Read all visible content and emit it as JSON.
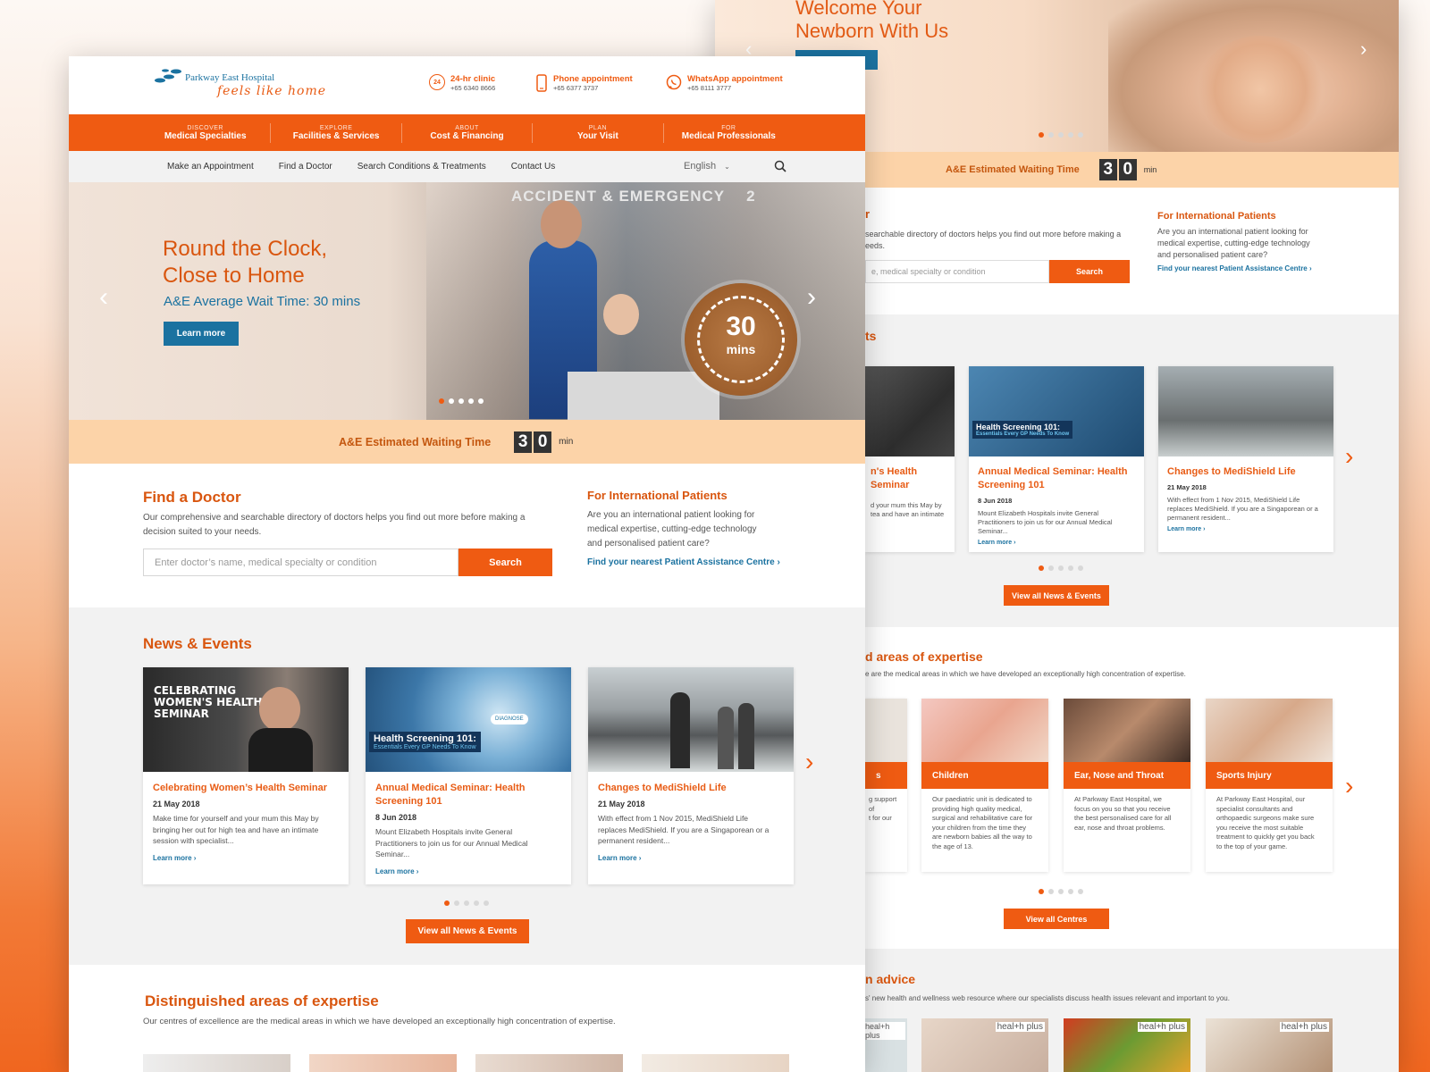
{
  "back": {
    "hero": {
      "title_line1": "Welcome Your",
      "title_line2": "Newborn With Us"
    },
    "ae_label": "A&E Estimated Waiting Time",
    "ae_digits": [
      "3",
      "0"
    ],
    "ae_unit": "min",
    "doctor_partial": "r",
    "doctor_desc": "searchable directory of doctors helps you find out more before making a",
    "doctor_desc2": "eeds.",
    "search_placeholder": "e, medical specialty or condition",
    "search_button": "Search",
    "intl_title": "For International Patients",
    "intl_desc": [
      "Are you an international patient looking for",
      "medical expertise, cutting-edge technology",
      "and personalised patient care?"
    ],
    "intl_link": "Find your nearest Patient Assistance Centre ›",
    "news_partial": "ts",
    "news": [
      {
        "title": "n's Health Seminar",
        "text": [
          "d your mum this May by",
          "tea and have an intimate"
        ]
      },
      {
        "title": "Annual Medical Seminar: Health Screening 101",
        "date": "8 Jun 2018",
        "text": [
          "Mount Elizabeth Hospitals invite General",
          "Practitioners to join us for our Annual Medical",
          "Seminar..."
        ],
        "more": "Learn more ›",
        "img_text": "Health Screening 101:",
        "img_sub": "Essentials Every GP Needs To Know"
      },
      {
        "title": "Changes to MediShield Life",
        "date": "21 May 2018",
        "text": [
          "With effect from 1 Nov 2015, MediShield Life",
          "replaces MediShield. If you are a Singaporean or a",
          "permanent resident..."
        ],
        "more": "Learn more ›"
      }
    ],
    "view_news": "View all News & Events",
    "exp_title_partial": "d areas of expertise",
    "exp_desc_partial": "e are the medical areas in which we have developed an exceptionally high concentration of expertise.",
    "exp": [
      {
        "title": "s",
        "text": [
          "g support",
          "of",
          "",
          "t for our"
        ]
      },
      {
        "title": "Children",
        "text": [
          "Our paediatric unit is dedicated to",
          "providing high quality medical,",
          "surgical and rehabilitative care for",
          "your children from the time they",
          "are newborn babies all the way to",
          "the age of 13."
        ]
      },
      {
        "title": "Ear, Nose and Throat",
        "text": [
          "At Parkway East Hospital, we",
          "focus on you so that you receive",
          "the best personalised care for all",
          "ear, nose and throat problems."
        ]
      },
      {
        "title": "Sports Injury",
        "text": [
          "At Parkway East Hospital, our",
          "specialist consultants and",
          "orthopaedic surgeons make sure",
          "you receive the most suitable",
          "treatment to quickly get you back",
          "to the top of your game."
        ]
      }
    ],
    "view_centres": "View all Centres",
    "advice_partial": "n advice",
    "advice_desc_partial": "s' new health and wellness web resource where our specialists discuss health issues relevant and important to you.",
    "health_logo": "heal+h plus"
  },
  "front": {
    "logo_name": "Parkway East Hospital",
    "logo_tagline": "feels like home",
    "contacts": [
      {
        "label": "24-hr clinic",
        "number": "+65 6340 8666",
        "icon": "24h-icon"
      },
      {
        "label": "Phone appointment",
        "number": "+65 6377 3737",
        "icon": "phone-icon"
      },
      {
        "label": "WhatsApp appointment",
        "number": "+65 8111 3777",
        "icon": "whatsapp-icon"
      }
    ],
    "nav": [
      {
        "kicker": "DISCOVER",
        "label": "Medical Specialties"
      },
      {
        "kicker": "EXPLORE",
        "label": "Facilities & Services"
      },
      {
        "kicker": "ABOUT",
        "label": "Cost & Financing"
      },
      {
        "kicker": "PLAN",
        "label": "Your Visit"
      },
      {
        "kicker": "FOR",
        "label": "Medical Professionals"
      }
    ],
    "subnav": [
      "Make an Appointment",
      "Find a Doctor",
      "Search Conditions & Treatments",
      "Contact Us"
    ],
    "language": "English",
    "hero": {
      "title_line1": "Round the Clock,",
      "title_line2": "Close to Home",
      "subtitle": "A&E Average Wait Time: 30 mins",
      "button": "Learn more",
      "sign": "ACCIDENT & EMERGENCY",
      "sign_num": "2",
      "badge_num": "30",
      "badge_unit": "mins",
      "slides": 5,
      "active_slide": 0
    },
    "ae_label": "A&E Estimated Waiting Time",
    "ae_digits": [
      "3",
      "0"
    ],
    "ae_unit": "min",
    "doctor": {
      "title": "Find a Doctor",
      "desc1": "Our comprehensive and searchable directory of doctors helps you find out more before making a",
      "desc2": "decision suited to your needs.",
      "placeholder": "Enter doctor’s name, medical specialty or condition",
      "button": "Search"
    },
    "intl": {
      "title": "For International Patients",
      "desc": [
        "Are you an international patient looking for",
        "medical expertise, cutting-edge technology",
        "and personalised patient care?"
      ],
      "link": "Find your nearest Patient Assistance Centre ›"
    },
    "news_title": "News & Events",
    "news": [
      {
        "title": "Celebrating Women’s Health Seminar",
        "date": "21 May 2018",
        "text": [
          "Make time for yourself and your mum this May by",
          "bringing her out for high tea and have an intimate",
          "session with specialist..."
        ],
        "more": "Learn more ›",
        "img_text": [
          "CELEBRATING",
          "WOMEN'S HEALTH",
          "SEMINAR"
        ]
      },
      {
        "title": "Annual Medical Seminar: Health Screening 101",
        "date": "8 Jun 2018",
        "text": [
          "Mount Elizabeth Hospitals invite General",
          "Practitioners to join us for our Annual Medical",
          "Seminar..."
        ],
        "more": "Learn more ›",
        "img_text": "Health Screening 101:",
        "img_sub": "Essentials Every GP Needs To Know",
        "img_badge": "DIAGNOSE"
      },
      {
        "title": "Changes to MediShield Life",
        "date": "21 May 2018",
        "text": [
          "With effect from 1 Nov 2015, MediShield Life",
          "replaces MediShield. If you are a Singaporean or a",
          "permanent resident..."
        ],
        "more": "Learn more ›"
      }
    ],
    "view_news": "View all News & Events",
    "exp_title": "Distinguished areas of expertise",
    "exp_desc": "Our centres of excellence are the medical areas in which we have developed an exceptionally high concentration of expertise."
  },
  "colors": {
    "brand": "#ef5b12",
    "link": "#1b72a0",
    "ae_bar": "#fcd3a8"
  }
}
